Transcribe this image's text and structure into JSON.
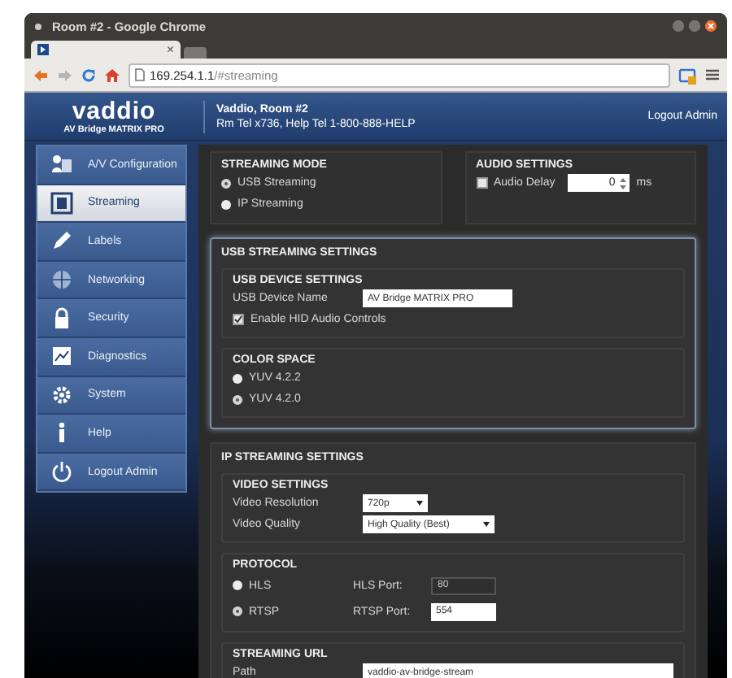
{
  "window": {
    "title": "Room #2 - Google Chrome",
    "tab_close": "×"
  },
  "toolbar": {
    "url_host": "169.254.1.1",
    "url_path": "/#streaming"
  },
  "header": {
    "logo": "vaddio",
    "product": "AV Bridge MATRIX PRO",
    "room": "Vaddio, Room #2",
    "phones": "Rm Tel x736, Help Tel 1-800-888-HELP",
    "logout": "Logout Admin"
  },
  "sidebar": {
    "items": [
      {
        "label": "A/V Configuration",
        "selected": false
      },
      {
        "label": "Streaming",
        "selected": true
      },
      {
        "label": "Labels",
        "selected": false
      },
      {
        "label": "Networking",
        "selected": false
      },
      {
        "label": "Security",
        "selected": false
      },
      {
        "label": "Diagnostics",
        "selected": false
      },
      {
        "label": "System",
        "selected": false
      },
      {
        "label": "Help",
        "selected": false
      },
      {
        "label": "Logout Admin",
        "selected": false
      }
    ]
  },
  "streaming_mode": {
    "title": "STREAMING MODE",
    "options": [
      {
        "label": "USB Streaming",
        "selected": true
      },
      {
        "label": "IP Streaming",
        "selected": false
      }
    ]
  },
  "audio_settings": {
    "title": "AUDIO SETTINGS",
    "delay": {
      "label": "Audio Delay",
      "checked": false,
      "value": "0",
      "unit": "ms"
    }
  },
  "usb_streaming": {
    "title": "USB STREAMING SETTINGS",
    "device_settings": {
      "title": "USB DEVICE SETTINGS",
      "name_label": "USB Device Name",
      "name_value": "AV Bridge MATRIX PRO",
      "hid": {
        "label": "Enable HID Audio Controls",
        "checked": true
      }
    },
    "color_space": {
      "title": "COLOR SPACE",
      "options": [
        {
          "label": "YUV 4.2.2",
          "selected": false
        },
        {
          "label": "YUV 4.2.0",
          "selected": true
        }
      ]
    }
  },
  "ip_streaming": {
    "title": "IP STREAMING SETTINGS",
    "video_settings": {
      "title": "VIDEO SETTINGS",
      "resolution": {
        "label": "Video Resolution",
        "value": "720p"
      },
      "quality": {
        "label": "Video Quality",
        "value": "High Quality (Best)"
      }
    },
    "protocol": {
      "title": "PROTOCOL",
      "options": [
        {
          "label": "HLS",
          "selected": false,
          "port_label": "HLS Port:",
          "port_value": "80",
          "disabled": true
        },
        {
          "label": "RTSP",
          "selected": true,
          "port_label": "RTSP Port:",
          "port_value": "554",
          "disabled": false
        }
      ]
    },
    "streaming_url": {
      "title": "STREAMING URL",
      "path_label": "Path",
      "path_value": "vaddio-av-bridge-stream"
    }
  }
}
